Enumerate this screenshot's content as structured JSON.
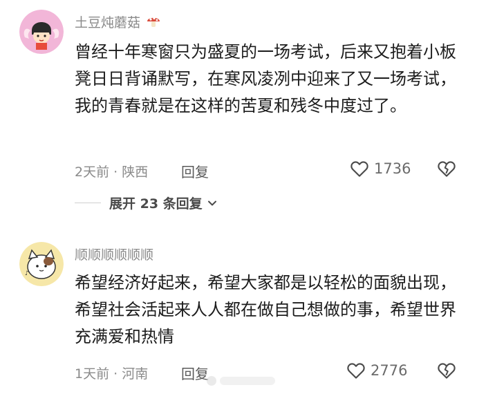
{
  "comments": [
    {
      "username": "土豆炖蘑菇",
      "username_emoji": "mushroom-emoji",
      "content": "曾经十年寒窗只为盛夏的一场考试，后来又抱着小板凳日日背诵默写，在寒风凌冽中迎来了又一场考试，我的青春就是在这样的苦夏和残冬中度过了。",
      "time": "2天前",
      "separator": "·",
      "location": "陕西",
      "reply_label": "回复",
      "like_count": "1736",
      "expand_label": "展开 23 条回复"
    },
    {
      "username": "顺顺顺顺顺顺",
      "content": "希望经济好起来，希望大家都是以轻松的面貌出现，希望社会活起来人人都在做自己想做的事，希望世界充满爱和热情",
      "time": "1天前",
      "separator": "·",
      "location": "河南",
      "reply_label": "回复",
      "like_count": "2776"
    }
  ],
  "icons": {
    "like": "heart-outline-icon",
    "dislike": "broken-heart-icon",
    "expand": "chevron-down-icon"
  },
  "colors": {
    "text_primary": "#1c1c1c",
    "text_secondary": "#8a8a8a",
    "background": "#ffffff"
  }
}
